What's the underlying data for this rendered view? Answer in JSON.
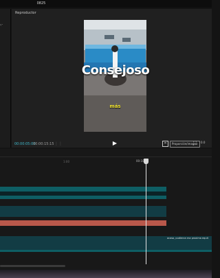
{
  "app": {
    "title": "0825"
  },
  "player": {
    "title": "Reproductor",
    "overlay_caption": "Consejoso",
    "overlay_subcaption": "más",
    "time_current": "00:00:05:00",
    "time_total": "00:00:15:15",
    "ratio_label": "Proporción/imagen",
    "more_label": "0.0"
  },
  "timeline": {
    "ruler_ticks": [
      "1:00",
      "10:00"
    ],
    "playhead_time": "00:10",
    "clip_label": "acaso, pudieron ma proxima equit"
  },
  "icons": {
    "left_glyph": "chevron",
    "grid": "grid-icon",
    "play": "play-icon",
    "crop": "crop-icon",
    "fullscreen": "fullscreen-icon"
  },
  "colors": {
    "accent": "#3fb6c8",
    "caption_yellow": "#f2e533",
    "audio_track": "#b9584b",
    "video_track": "#0e5e64"
  }
}
